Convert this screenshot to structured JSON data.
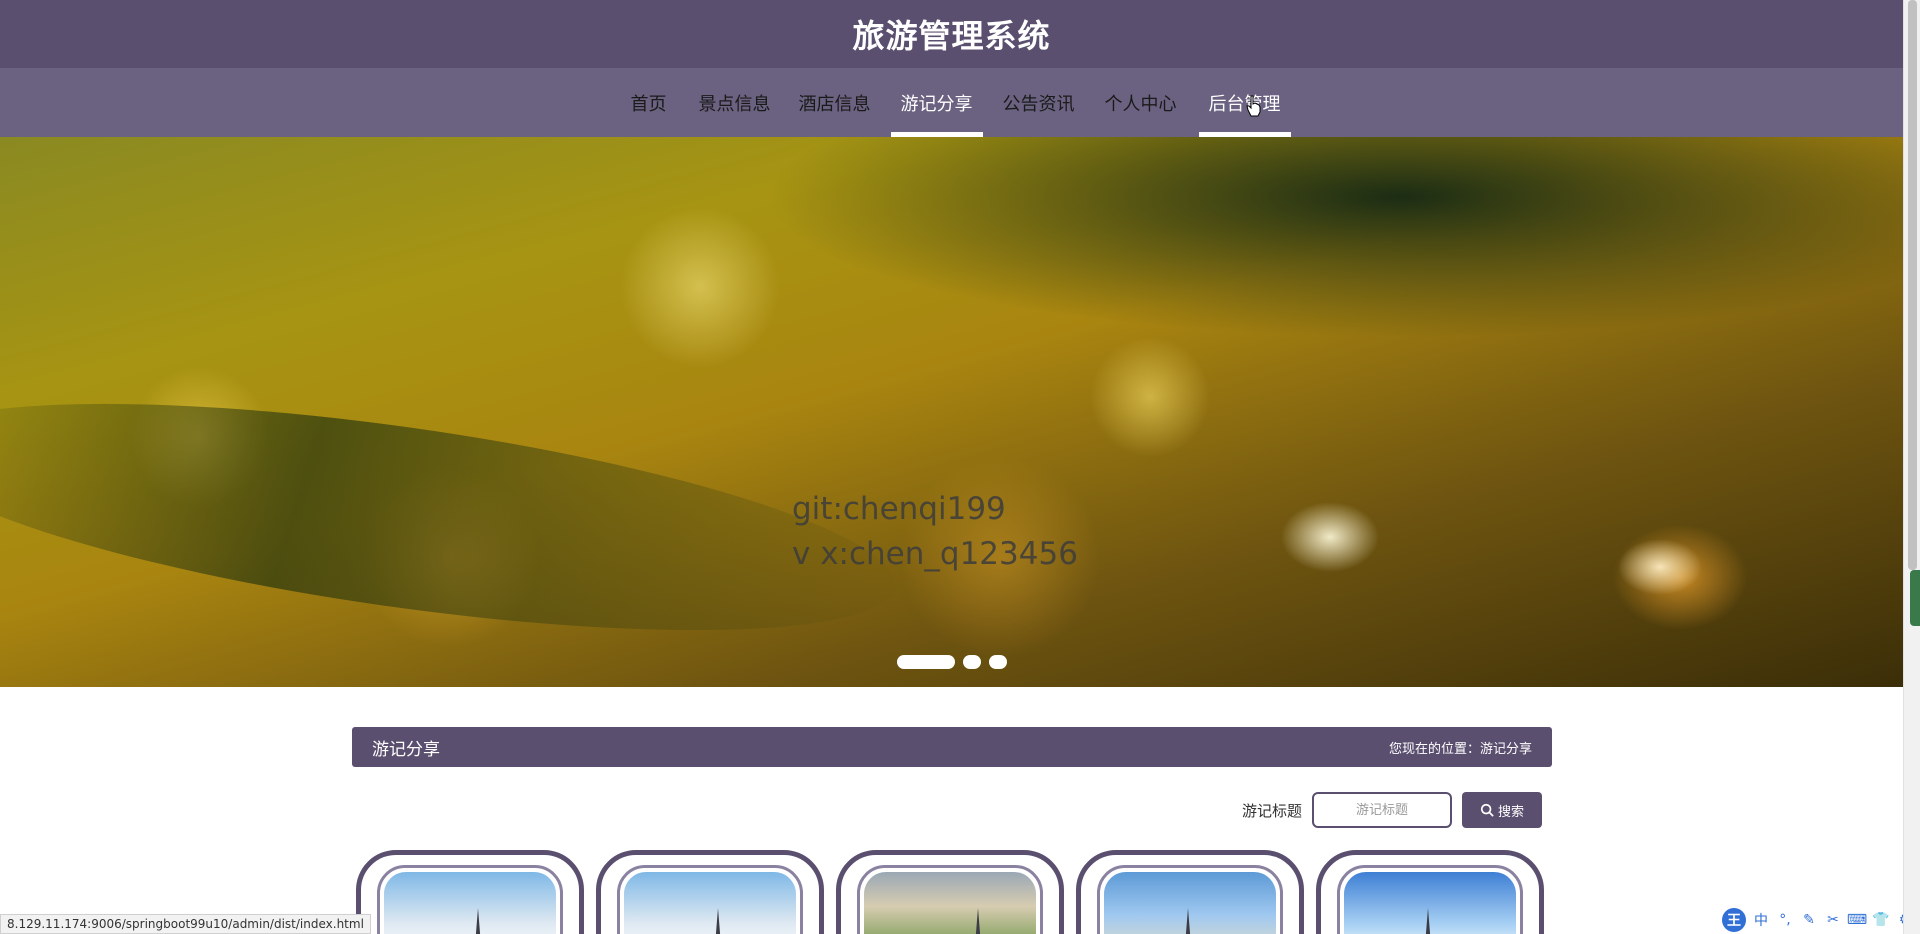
{
  "header": {
    "title": "旅游管理系统"
  },
  "nav": {
    "items": [
      {
        "label": "首页",
        "state": "normal"
      },
      {
        "label": "景点信息",
        "state": "normal"
      },
      {
        "label": "酒店信息",
        "state": "normal"
      },
      {
        "label": "游记分享",
        "state": "active"
      },
      {
        "label": "公告资讯",
        "state": "normal"
      },
      {
        "label": "个人中心",
        "state": "normal"
      },
      {
        "label": "后台管理",
        "state": "hover"
      }
    ]
  },
  "banner": {
    "caption_line1": "git:chenqi199",
    "caption_line2": "v x:chen_q123456",
    "slide_count": 3,
    "active_slide": 1
  },
  "section": {
    "title": "游记分享",
    "location_label": "您现在的位置：",
    "location_value": "游记分享"
  },
  "search": {
    "label": "游记标题",
    "placeholder": "游记标题",
    "button_label": "搜索",
    "button_icon": "search-icon"
  },
  "cards": [
    {
      "image": "tower-sky-clouds"
    },
    {
      "image": "tower-sky-clouds"
    },
    {
      "image": "cathedral-trees"
    },
    {
      "image": "eiffel-tower-sky"
    },
    {
      "image": "tower-blue-sky"
    }
  ],
  "status_bar": {
    "url": "8.129.11.174:9006/springboot99u10/admin/dist/index.html"
  },
  "tray": {
    "main_icon": "王",
    "items": [
      "中",
      "°,",
      "✎",
      "✂",
      "⌨",
      "👕",
      "⚙"
    ]
  },
  "colors": {
    "primary": "#5b4f70",
    "nav_bg": "#6a6280",
    "white": "#ffffff"
  }
}
